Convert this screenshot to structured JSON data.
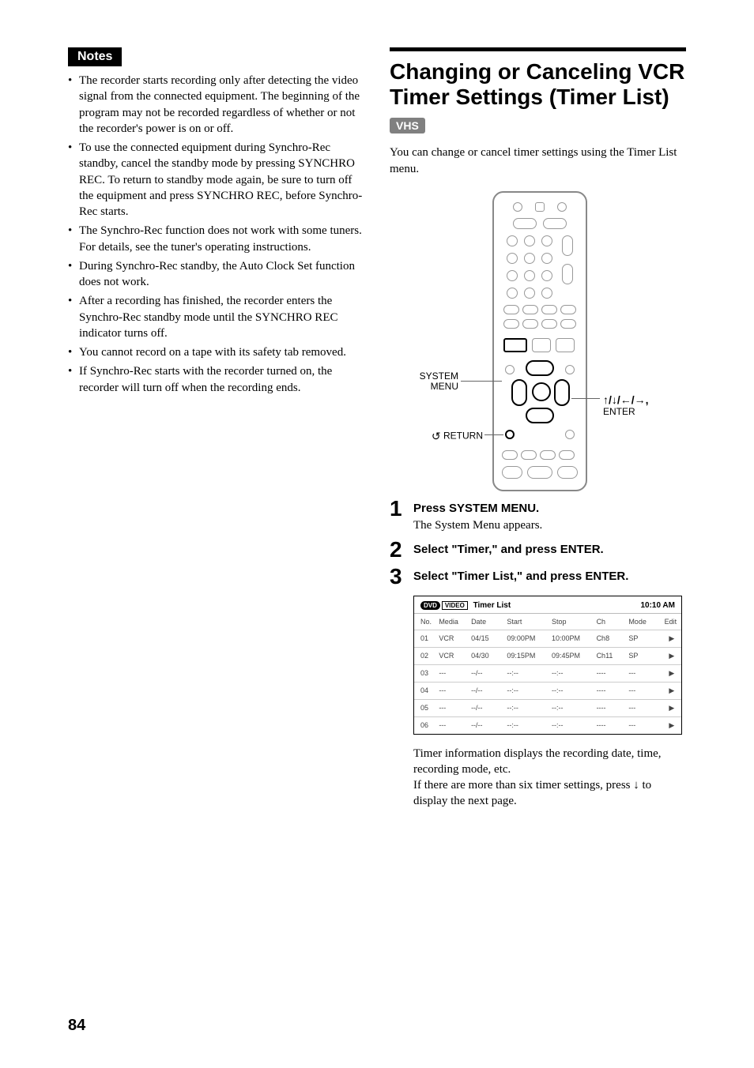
{
  "left": {
    "notes_label": "Notes",
    "notes": [
      "The recorder starts recording only after detecting the video signal from the connected equipment. The beginning of the program may not be recorded regardless of whether or not the recorder's power is on or off.",
      "To use the connected equipment during Synchro-Rec standby, cancel the standby mode by pressing SYNCHRO REC. To return to standby mode again, be sure to turn off the equipment and press SYNCHRO REC, before Synchro-Rec starts.",
      "The Synchro-Rec function does not work with some tuners. For details, see the tuner's operating instructions.",
      "During Synchro-Rec standby, the Auto Clock Set function does not work.",
      "After a recording has finished, the recorder enters the Synchro-Rec standby mode until the SYNCHRO REC indicator turns off.",
      "You cannot record on a tape with its safety tab removed.",
      "If Synchro-Rec starts with the recorder turned on, the recorder will turn off when the recording ends."
    ]
  },
  "right": {
    "title": "Changing or Canceling VCR Timer Settings (Timer List)",
    "vhs_label": "VHS",
    "intro": "You can change or cancel timer settings using the Timer List menu.",
    "remote": {
      "system_menu": "SYSTEM MENU",
      "return": "RETURN",
      "arrows_glyphs": "↑/↓/←/→,",
      "enter": "ENTER"
    },
    "steps": {
      "s1": {
        "num": "1",
        "head": "Press SYSTEM MENU.",
        "sub": "The System Menu appears."
      },
      "s2": {
        "num": "2",
        "head": "Select \"Timer,\" and press ENTER."
      },
      "s3": {
        "num": "3",
        "head": "Select \"Timer List,\" and press ENTER."
      }
    },
    "timer_panel": {
      "dvd_icon": "DVD",
      "video_icon": "VIDEO",
      "title": "Timer List",
      "clock": "10:10 AM",
      "headers": {
        "no": "No.",
        "media": "Media",
        "date": "Date",
        "start": "Start",
        "stop": "Stop",
        "ch": "Ch",
        "mode": "Mode",
        "edit": "Edit"
      },
      "rows": [
        {
          "no": "01",
          "media": "VCR",
          "date": "04/15",
          "start": "09:00PM",
          "stop": "10:00PM",
          "ch": "Ch8",
          "mode": "SP"
        },
        {
          "no": "02",
          "media": "VCR",
          "date": "04/30",
          "start": "09:15PM",
          "stop": "09:45PM",
          "ch": "Ch11",
          "mode": "SP"
        },
        {
          "no": "03",
          "media": "---",
          "date": "--/--",
          "start": "--:--",
          "stop": "--:--",
          "ch": "----",
          "mode": "---"
        },
        {
          "no": "04",
          "media": "---",
          "date": "--/--",
          "start": "--:--",
          "stop": "--:--",
          "ch": "----",
          "mode": "---"
        },
        {
          "no": "05",
          "media": "---",
          "date": "--/--",
          "start": "--:--",
          "stop": "--:--",
          "ch": "----",
          "mode": "---"
        },
        {
          "no": "06",
          "media": "---",
          "date": "--/--",
          "start": "--:--",
          "stop": "--:--",
          "ch": "----",
          "mode": "---"
        }
      ],
      "edit_arrow": "▶"
    },
    "post1": "Timer information displays the recording date, time, recording mode, etc.",
    "post2a": "If there are more than six timer settings, press ",
    "post2_arrow": "↓",
    "post2b": " to display the next page."
  },
  "page_number": "84"
}
